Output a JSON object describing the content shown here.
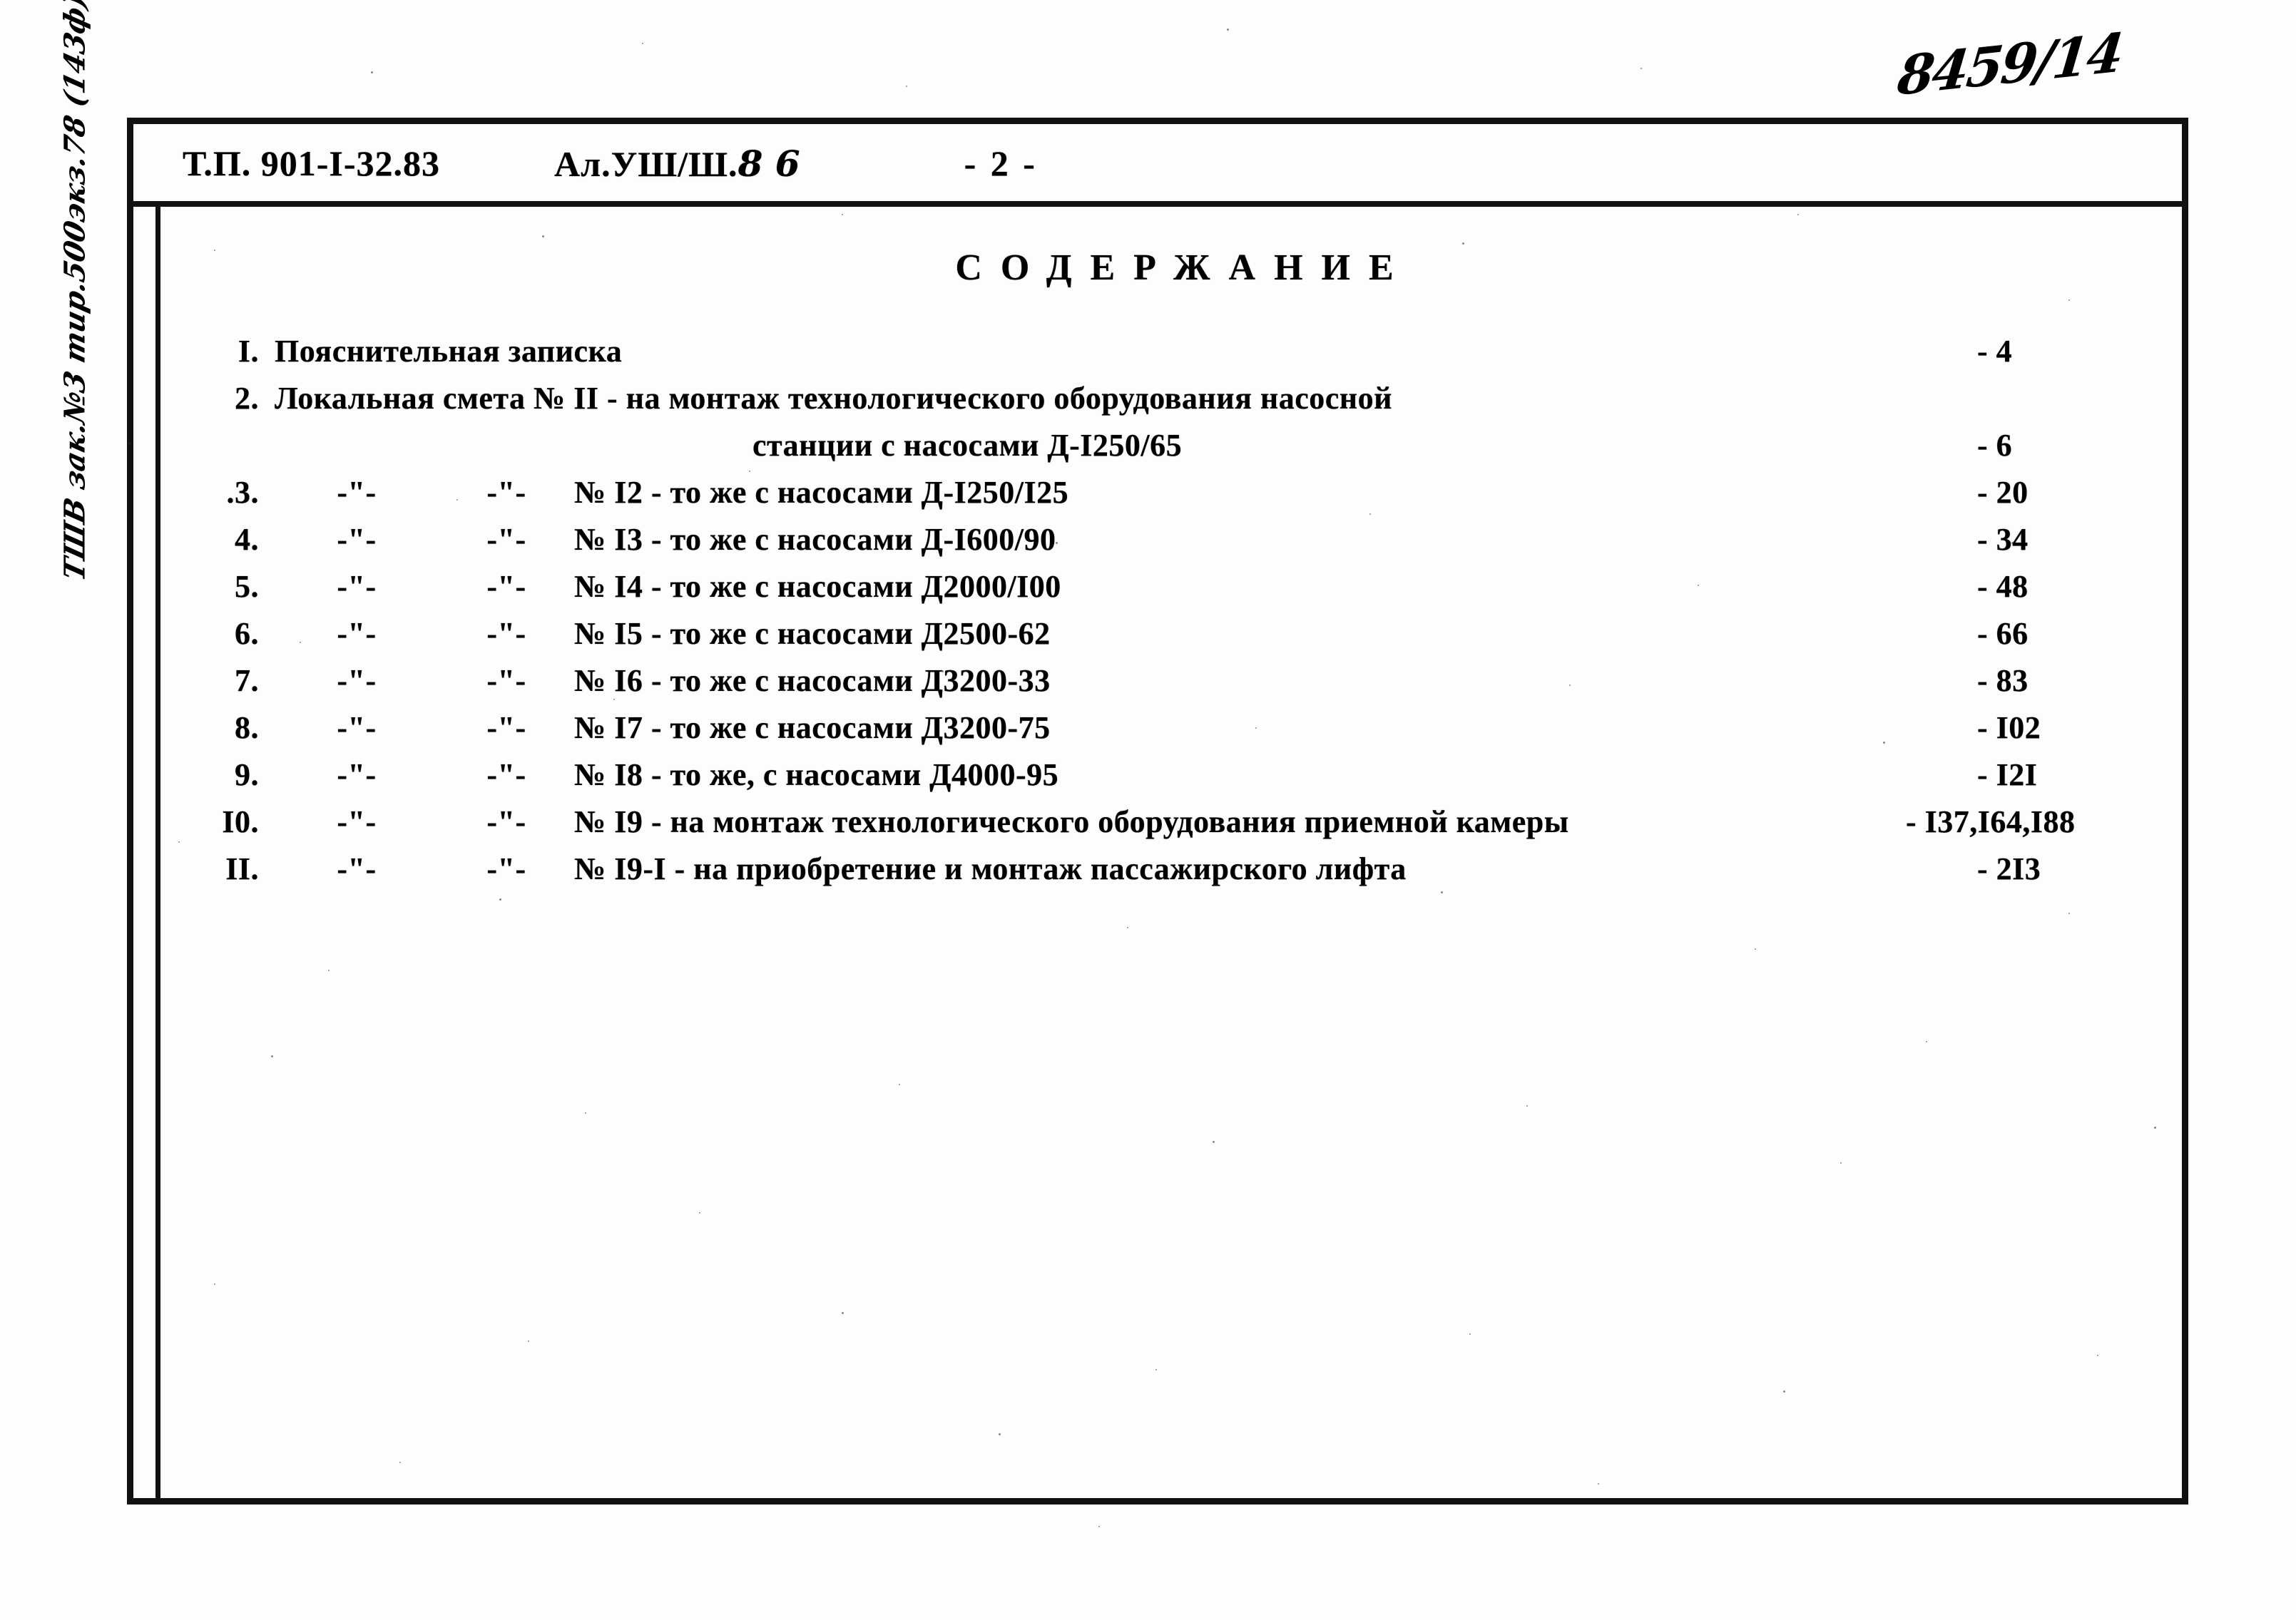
{
  "document": {
    "header": {
      "project_code": "Т.П.  901-I-32.83",
      "album": "Ал.УШ/Ш.",
      "album_handwritten": "8 6",
      "page_marker": "- 2 -"
    },
    "annotations": {
      "top_right_handwritten": "8459/14",
      "left_margin_handwritten": "ТШВ зак.№3 тир.500экз.78 (143ф)"
    },
    "toc_title": "СОДЕРЖАНИЕ",
    "ditto_mark": "-\"-",
    "rows": [
      {
        "num": "I.",
        "ditto1": "",
        "ditto2": "",
        "desc": "Пояснительная записка",
        "page": "- 4",
        "wide_desc": true
      },
      {
        "num": "2.",
        "ditto1": "",
        "ditto2": "",
        "desc": "Локальная смета № II - на монтаж технологического оборудования насосной",
        "cont": "станции с насосами Д-I250/65",
        "page": "- 6",
        "wide_desc": true
      },
      {
        "num": ".3.",
        "ditto1": "-\"-",
        "ditto2": "-\"-",
        "desc": "№ I2 - то же с насосами Д-I250/I25",
        "page": "- 20"
      },
      {
        "num": "4.",
        "ditto1": "-\"-",
        "ditto2": "-\"-",
        "desc": "№ I3 - то же с насосами Д-I600/90",
        "page": "- 34"
      },
      {
        "num": "5.",
        "ditto1": "-\"-",
        "ditto2": "-\"-",
        "desc": "№ I4 - то же  с насосами Д2000/I00",
        "page": "- 48"
      },
      {
        "num": "6.",
        "ditto1": "-\"-",
        "ditto2": "-\"-",
        "desc": "№ I5 - то же с насосами Д2500-62",
        "page": "- 66"
      },
      {
        "num": "7.",
        "ditto1": "-\"-",
        "ditto2": "-\"-",
        "desc": "№ I6 - то же с насосами Д3200-33",
        "page": "- 83"
      },
      {
        "num": "8.",
        "ditto1": "-\"-",
        "ditto2": "-\"-",
        "desc": "№ I7 - то же  с насосами Д3200-75",
        "page": "- I02"
      },
      {
        "num": "9.",
        "ditto1": "-\"-",
        "ditto2": "-\"-",
        "desc": "№ I8 - то же, с насосами Д4000-95",
        "page": "- I2I"
      },
      {
        "num": "I0.",
        "ditto1": "-\"-",
        "ditto2": "-\"-",
        "desc": "№ I9 - на монтаж технологического оборудования приемной камеры",
        "page": "- I37,I64,I88"
      },
      {
        "num": "II.",
        "ditto1": "-\"-",
        "ditto2": "-\"-",
        "desc": "№ I9-I - на приобретение и монтаж пассажирского лифта",
        "page": "- 2I3"
      }
    ]
  }
}
